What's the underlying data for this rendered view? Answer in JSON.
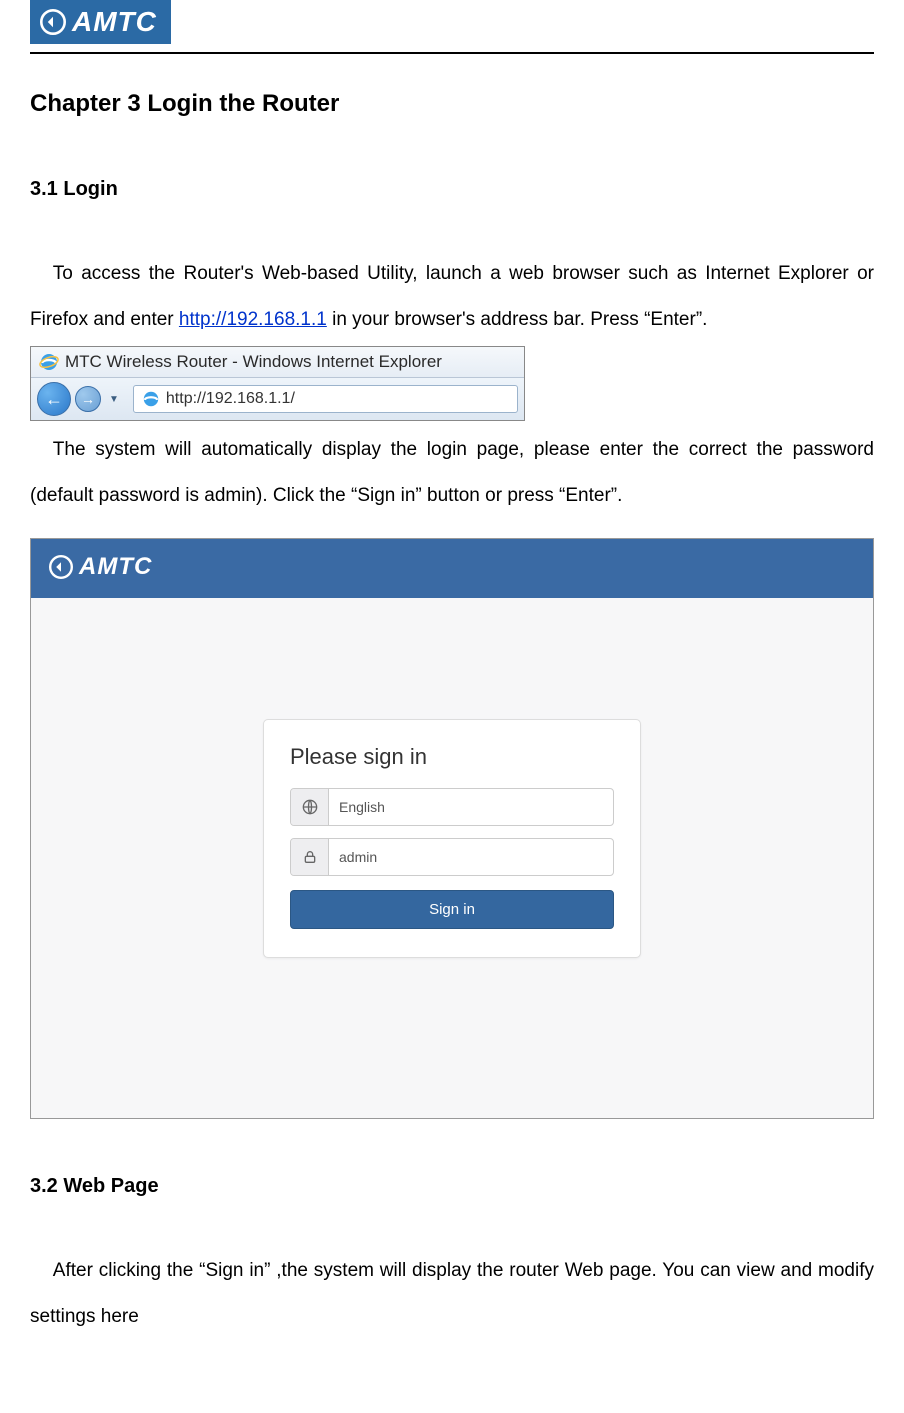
{
  "brand": "AMTC",
  "chapter_title": "Chapter 3 Login the Router",
  "section_31_title": "3.1 Login",
  "para_31_a_pre": "To access the Router's Web-based Utility, launch a web browser such as Internet Explorer or Firefox and enter ",
  "login_url": "http://192.168.1.1",
  "para_31_a_post": " in your browser's address bar. Press “Enter”.",
  "ie_window_title": "MTC Wireless Router - Windows Internet Explorer",
  "ie_address": "http://192.168.1.1/",
  "para_31_b": "The system will automatically display the login page, please enter the correct the password (default password is admin). Click the “Sign in” button or press “Enter”.",
  "login_card": {
    "heading": "Please sign in",
    "language_value": "English",
    "password_value": "admin",
    "button_label": "Sign in"
  },
  "section_32_title": "3.2 Web Page",
  "para_32": "After clicking the “Sign in” ,the system will display the router Web page. You can view and modify settings here"
}
